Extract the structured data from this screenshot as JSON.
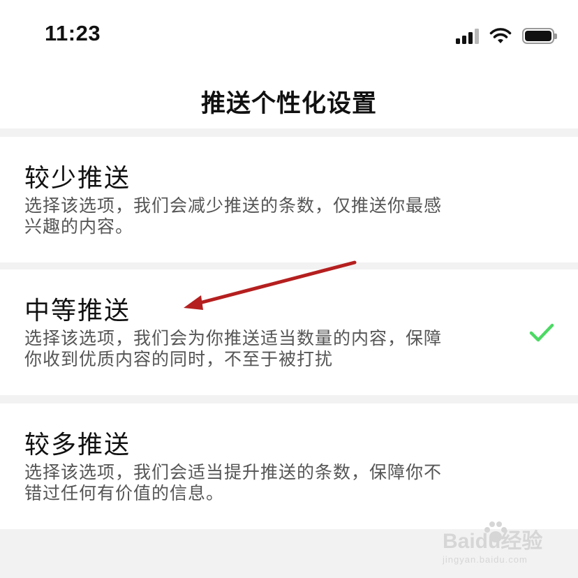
{
  "status_bar": {
    "time": "11:23",
    "icons": [
      "cellular-signal-icon",
      "wifi-icon",
      "battery-icon"
    ]
  },
  "nav": {
    "title": "推送个性化设置"
  },
  "options": [
    {
      "title": "较少推送",
      "description": "选择该选项，我们会减少推送的条数，仅推送你最感兴趣的内容。",
      "selected": false
    },
    {
      "title": "中等推送",
      "description": "选择该选项，我们会为你推送适当数量的内容，保障你收到优质内容的同时，不至于被打扰",
      "selected": true
    },
    {
      "title": "较多推送",
      "description": "选择该选项，我们会适当提升推送的条数，保障你不错过任何有价值的信息。",
      "selected": false
    }
  ],
  "colors": {
    "check": "#4cd964",
    "annotation_arrow": "#b51f1f",
    "page_background": "#f2f2f2"
  },
  "watermark": {
    "logo": "Baidu经验",
    "sub": "jingyan.baidu.com"
  }
}
